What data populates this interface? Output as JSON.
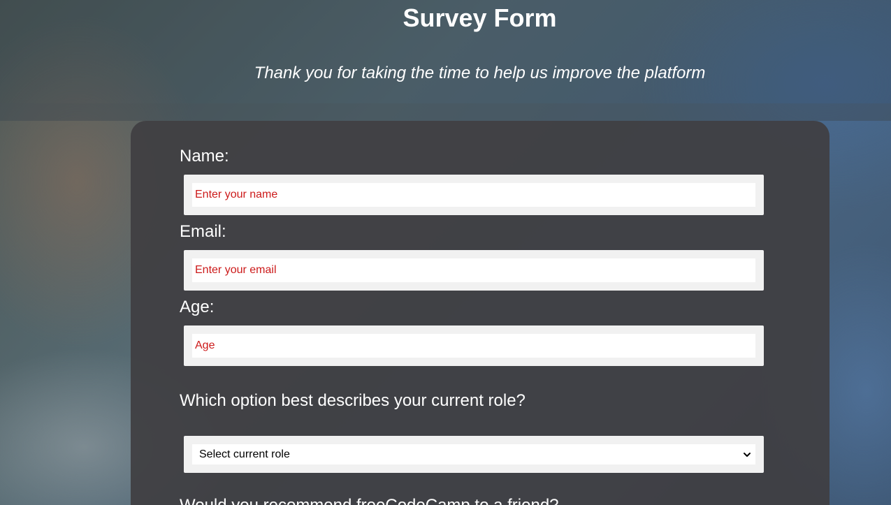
{
  "header": {
    "title": "Survey Form",
    "subtitle": "Thank you for taking the time to help us improve the platform"
  },
  "form": {
    "name": {
      "label": "Name:",
      "placeholder": "Enter your name",
      "value": ""
    },
    "email": {
      "label": "Email:",
      "placeholder": "Enter your email",
      "value": ""
    },
    "age": {
      "label": "Age:",
      "placeholder": "Age",
      "value": ""
    },
    "role": {
      "question": "Which option best describes your current role?",
      "selected": "Select current role"
    },
    "recommend": {
      "question": "Would you recommend freeCodeCamp to a friend?"
    }
  },
  "colors": {
    "placeholder_text": "#cc1a1a",
    "panel": "#403e42",
    "input_frame": "#f1f1f1"
  },
  "icons": {
    "select_arrow": "chevron-down-icon"
  }
}
